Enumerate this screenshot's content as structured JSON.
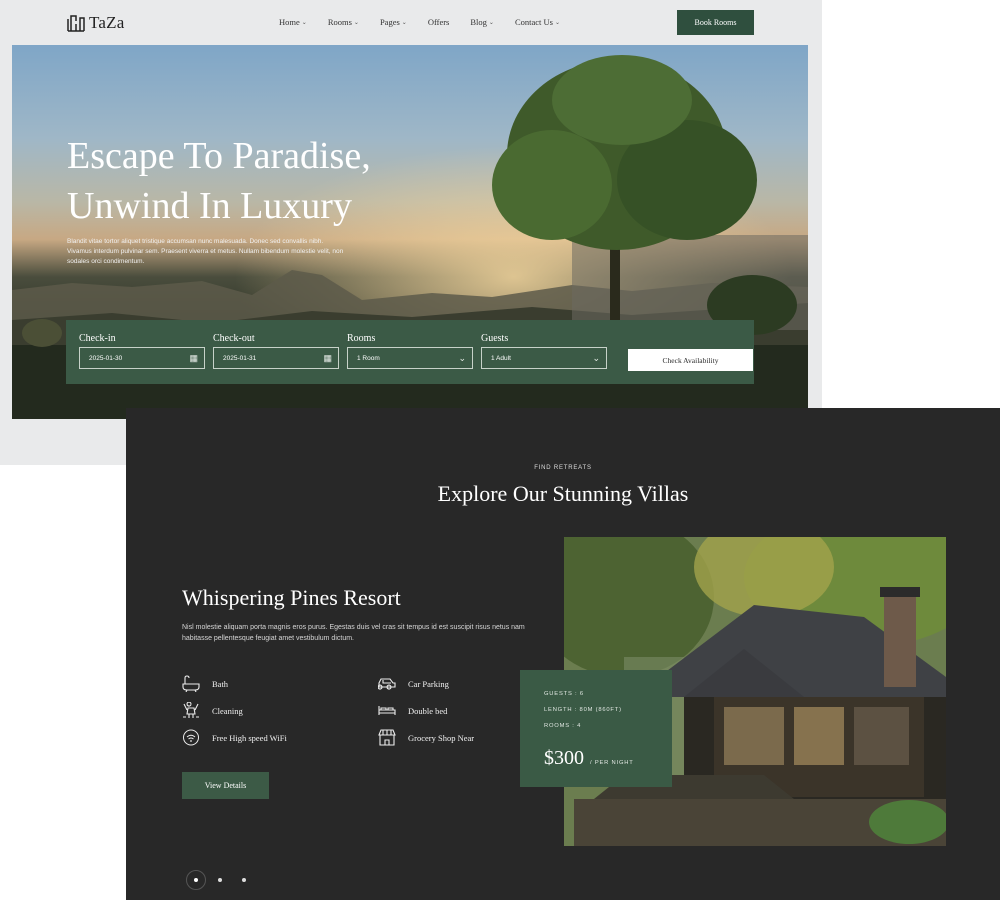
{
  "brand": {
    "name": "TaZa"
  },
  "nav": {
    "items": [
      {
        "label": "Home",
        "has_dropdown": true
      },
      {
        "label": "Rooms",
        "has_dropdown": true
      },
      {
        "label": "Pages",
        "has_dropdown": true
      },
      {
        "label": "Offers",
        "has_dropdown": false
      },
      {
        "label": "Blog",
        "has_dropdown": true
      },
      {
        "label": "Contact Us",
        "has_dropdown": true
      }
    ],
    "cta": "Book Rooms"
  },
  "hero": {
    "title_line1": "Escape To Paradise,",
    "title_line2": "Unwind In Luxury",
    "description": "Blandit vitae tortor aliquet tristique accumsan nunc malesuada. Donec sed convallis nibh. Vivamus interdum pulvinar sem. Praesent viverra et metus. Nullam bibendum molestie velit, non sodales orci condimentum."
  },
  "booking": {
    "checkin": {
      "label": "Check-in",
      "value": "2025-01-30"
    },
    "checkout": {
      "label": "Check-out",
      "value": "2025-01-31"
    },
    "rooms": {
      "label": "Rooms",
      "value": "1 Room"
    },
    "guests": {
      "label": "Guests",
      "value": "1 Adult"
    },
    "button": "Check Availability"
  },
  "villas": {
    "eyebrow": "FIND RETREATS",
    "title": "Explore Our Stunning Villas",
    "name": "Whispering Pines Resort",
    "description": "Nisl molestie aliquam porta magnis eros purus. Egestas duis vel cras sit tempus id est suscipit risus netus nam habitasse pellentesque feugiat amet vestibulum dictum.",
    "amenities": [
      {
        "label": "Bath",
        "icon": "bathtub-icon"
      },
      {
        "label": "Car Parking",
        "icon": "car-icon"
      },
      {
        "label": "Cleaning",
        "icon": "cleaning-icon"
      },
      {
        "label": "Double bed",
        "icon": "bed-icon"
      },
      {
        "label": "Free High speed WiFi",
        "icon": "wifi-icon"
      },
      {
        "label": "Grocery Shop Near",
        "icon": "shop-icon"
      }
    ],
    "view_button": "View Details",
    "card": {
      "guests": "GUESTS : 6",
      "length": "LENGTH : 80M (860FT)",
      "rooms": "ROOMS : 4",
      "price": "$300",
      "price_unit": "/ PER NIGHT"
    },
    "slider": {
      "total": 3,
      "active": 1
    }
  },
  "colors": {
    "accent_green": "#2f4f3e",
    "card_green": "#3a5a45",
    "dark_bg": "#282828",
    "light_bg": "#e9eaeb"
  }
}
